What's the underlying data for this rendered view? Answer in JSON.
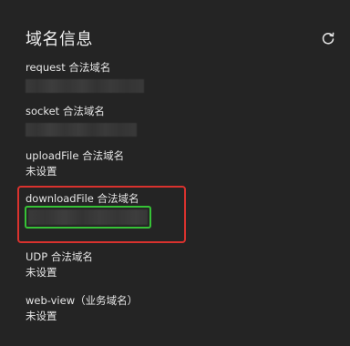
{
  "panel": {
    "title": "域名信息",
    "refresh_icon": "refresh-icon"
  },
  "domains": [
    {
      "label": "request 合法域名",
      "value": ""
    },
    {
      "label": "socket 合法域名",
      "value": ""
    },
    {
      "label": "uploadFile 合法域名",
      "value": "未设置"
    },
    {
      "label": "downloadFile 合法域名",
      "value": ""
    },
    {
      "label": "UDP 合法域名",
      "value": "未设置"
    },
    {
      "label": "web-view（业务域名）",
      "value": "未设置"
    }
  ],
  "annotations": {
    "highlight_color": "#d9322e",
    "value_highlight_color": "#36c236"
  }
}
